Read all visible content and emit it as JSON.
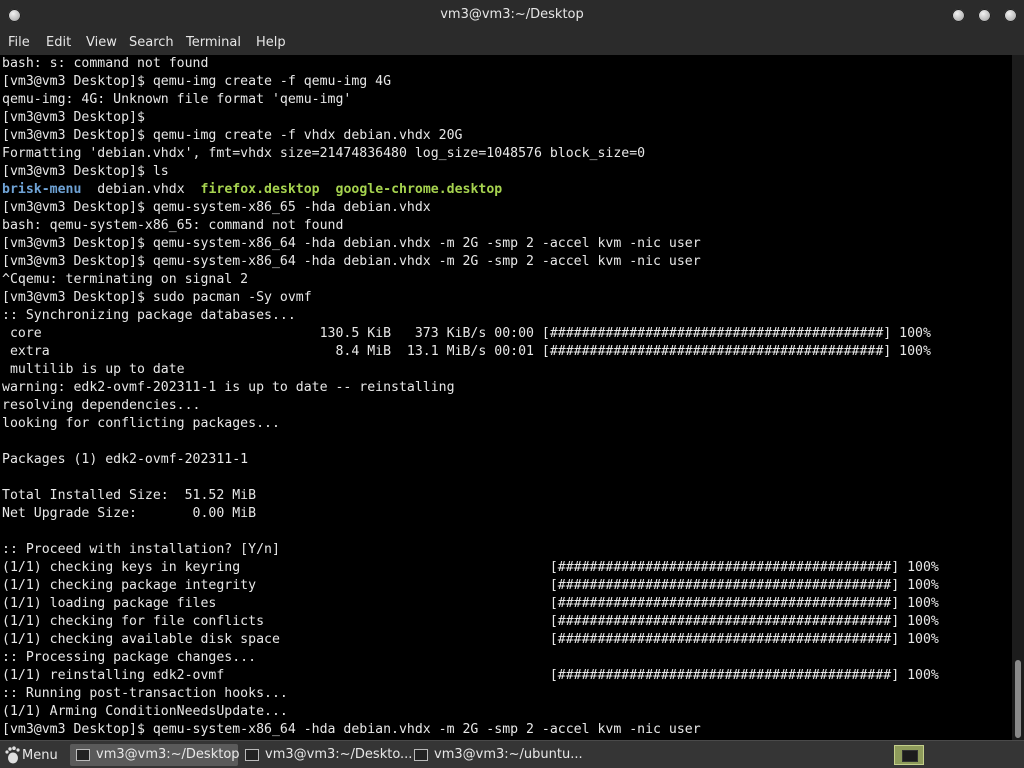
{
  "window": {
    "title": "vm3@vm3:~/Desktop"
  },
  "menubar": {
    "items": [
      "File",
      "Edit",
      "View",
      "Search",
      "Terminal",
      "Help"
    ]
  },
  "terminal": {
    "lines": [
      "bash: s: command not found",
      "[vm3@vm3 Desktop]$ qemu-img create -f qemu-img 4G",
      "qemu-img: 4G: Unknown file format 'qemu-img'",
      "[vm3@vm3 Desktop]$",
      "[vm3@vm3 Desktop]$ qemu-img create -f vhdx debian.vhdx 20G",
      "Formatting 'debian.vhdx', fmt=vhdx size=21474836480 log_size=1048576 block_size=0",
      "[vm3@vm3 Desktop]$ ls",
      "__LS__",
      "[vm3@vm3 Desktop]$ qemu-system-x86_65 -hda debian.vhdx",
      "bash: qemu-system-x86_65: command not found",
      "[vm3@vm3 Desktop]$ qemu-system-x86_64 -hda debian.vhdx -m 2G -smp 2 -accel kvm -nic user",
      "[vm3@vm3 Desktop]$ qemu-system-x86_64 -hda debian.vhdx -m 2G -smp 2 -accel kvm -nic user",
      "^Cqemu: terminating on signal 2",
      "[vm3@vm3 Desktop]$ sudo pacman -Sy ovmf",
      ":: Synchronizing package databases...",
      " core                                   130.5 KiB   373 KiB/s 00:00 [##########################################] 100%",
      " extra                                    8.4 MiB  13.1 MiB/s 00:01 [##########################################] 100%",
      " multilib is up to date",
      "warning: edk2-ovmf-202311-1 is up to date -- reinstalling",
      "resolving dependencies...",
      "looking for conflicting packages...",
      "",
      "Packages (1) edk2-ovmf-202311-1",
      "",
      "Total Installed Size:  51.52 MiB",
      "Net Upgrade Size:       0.00 MiB",
      "",
      ":: Proceed with installation? [Y/n]",
      "(1/1) checking keys in keyring                                       [##########################################] 100%",
      "(1/1) checking package integrity                                     [##########################################] 100%",
      "(1/1) loading package files                                          [##########################################] 100%",
      "(1/1) checking for file conflicts                                    [##########################################] 100%",
      "(1/1) checking available disk space                                  [##########################################] 100%",
      ":: Processing package changes...",
      "(1/1) reinstalling edk2-ovmf                                         [##########################################] 100%",
      ":: Running post-transaction hooks...",
      "(1/1) Arming ConditionNeedsUpdate...",
      "[vm3@vm3 Desktop]$ qemu-system-x86_64 -hda debian.vhdx -m 2G -smp 2 -accel kvm -nic user"
    ],
    "ls_output": [
      {
        "name": "brisk-menu",
        "color": "blue"
      },
      {
        "name": "debian.vhdx",
        "color": "default"
      },
      {
        "name": "firefox.desktop",
        "color": "green"
      },
      {
        "name": "google-chrome.desktop",
        "color": "green"
      }
    ],
    "colors": {
      "background": "#000000",
      "text": "#e8e8e8",
      "directory": "#6fa3d6",
      "executable": "#a6d34f"
    }
  },
  "taskbar": {
    "menu_label": "Menu",
    "tasks": [
      {
        "label": "vm3@vm3:~/Desktop",
        "active": true
      },
      {
        "label": "vm3@vm3:~/Deskto...",
        "active": false
      },
      {
        "label": "vm3@vm3:~/ubuntu...",
        "active": false
      }
    ],
    "tray_icon": "workspace-switcher-icon"
  }
}
